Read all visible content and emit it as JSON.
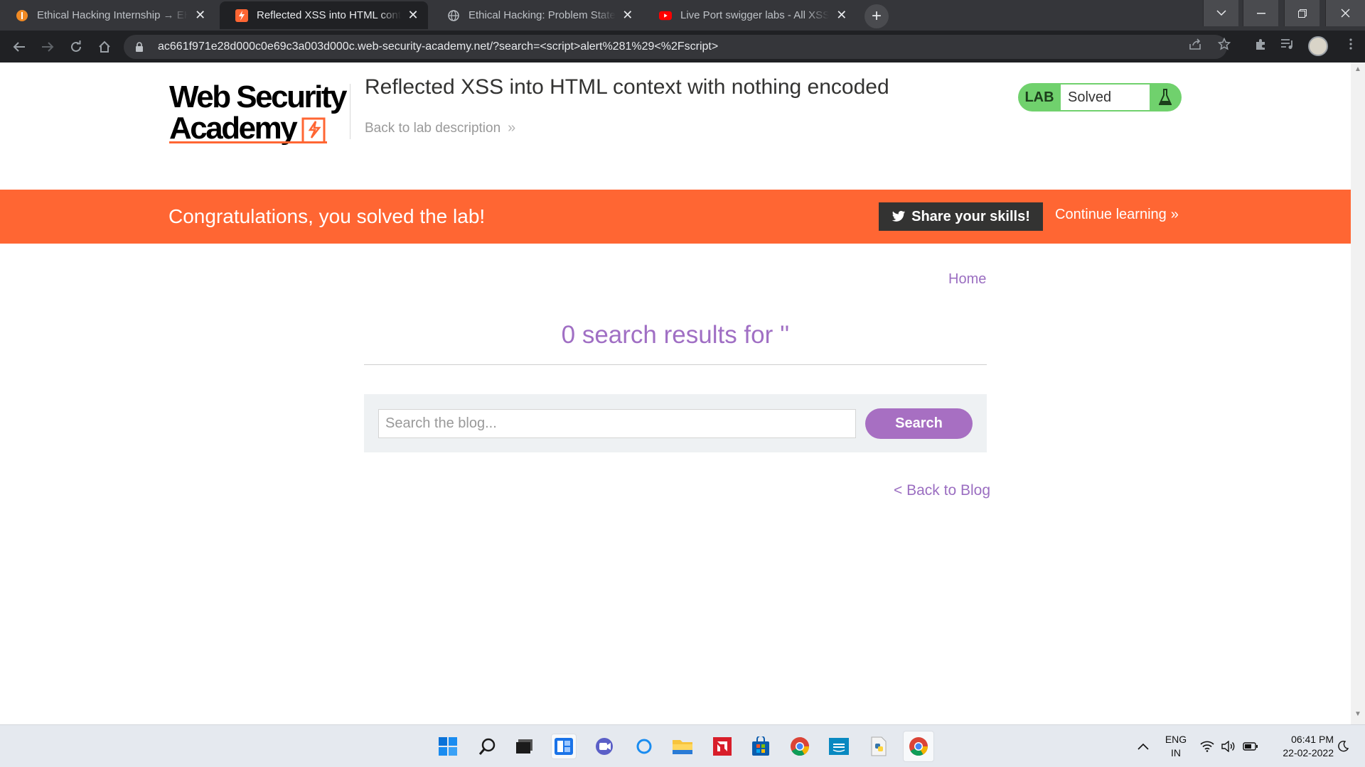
{
  "browser": {
    "tabs": [
      {
        "title": "Ethical Hacking Internship → EH Internship Problem",
        "icon": "internshala-icon",
        "active": false
      },
      {
        "title": "Reflected XSS into HTML context with nothing encoded",
        "icon": "portswigger-icon",
        "active": true
      },
      {
        "title": "Ethical Hacking: Problem Statement",
        "icon": "globe-icon",
        "active": false
      },
      {
        "title": "Live Port swigger labs - All XSS solutions",
        "icon": "youtube-icon",
        "active": false
      }
    ],
    "url": "ac661f971e28d000c0e69c3a003d000c.web-security-academy.net/?search=<script>alert%281%29<%2Fscript>"
  },
  "header": {
    "logo_line1": "Web Security",
    "logo_line2": "Academy",
    "lab_title": "Reflected XSS into HTML context with nothing encoded",
    "back_to_description": "Back to lab description",
    "lab_badge_label": "LAB",
    "lab_status": "Solved"
  },
  "banner": {
    "message": "Congratulations, you solved the lab!",
    "share_label": "Share your skills!",
    "continue_label": "Continue learning"
  },
  "main": {
    "home_link": "Home",
    "results_heading": "0 search results for ''",
    "search_placeholder": "Search the blog...",
    "search_button": "Search",
    "back_to_blog": "< Back to Blog"
  },
  "taskbar": {
    "language_line1": "ENG",
    "language_line2": "IN",
    "time": "06:41 PM",
    "date": "22-02-2022"
  },
  "colors": {
    "brand_orange": "#ff6633",
    "link_purple": "#9b6ec1",
    "button_purple": "#a76fc2",
    "lab_green": "#70d16d"
  }
}
